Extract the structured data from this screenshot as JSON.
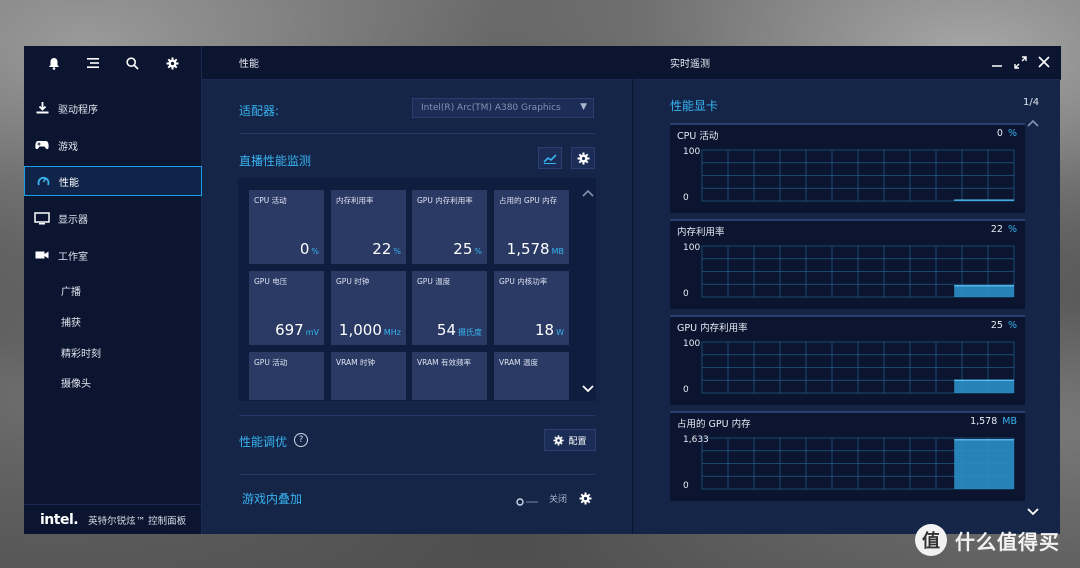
{
  "sidebar": {
    "top_icons": [
      "bell-icon",
      "menu-icon",
      "search-icon",
      "gear-icon"
    ],
    "items": [
      {
        "label": "驱动程序",
        "icon": "download-icon"
      },
      {
        "label": "游戏",
        "icon": "gamepad-icon"
      },
      {
        "label": "性能",
        "icon": "gauge-icon"
      },
      {
        "label": "显示器",
        "icon": "monitor-icon"
      },
      {
        "label": "工作室",
        "icon": "camera-icon"
      }
    ],
    "sub_items": [
      "广播",
      "捕获",
      "精彩时刻",
      "摄像头"
    ],
    "brand_logo": "intel.",
    "brand_text": "英特尔锐炫™ 控制面板"
  },
  "middle": {
    "header": "性能",
    "adapter_label": "适配器:",
    "adapter_value": "Intel(R) Arc(TM) A380 Graphics",
    "monitor_title": "直播性能监测",
    "tiles": [
      {
        "label": "CPU 活动",
        "value": "0",
        "unit": "%"
      },
      {
        "label": "内存利用率",
        "value": "22",
        "unit": "%"
      },
      {
        "label": "GPU 内存利用率",
        "value": "25",
        "unit": "%"
      },
      {
        "label": "占用的 GPU 内存",
        "value": "1,578",
        "unit": "MB"
      },
      {
        "label": "GPU 电压",
        "value": "697",
        "unit": "mV"
      },
      {
        "label": "GPU 时钟",
        "value": "1,000",
        "unit": "MHz"
      },
      {
        "label": "GPU 温度",
        "value": "54",
        "unit": "摄氏度"
      },
      {
        "label": "GPU 内核功率",
        "value": "18",
        "unit": "W"
      },
      {
        "label": "GPU 活动",
        "value": "",
        "unit": ""
      },
      {
        "label": "VRAM 时钟",
        "value": "",
        "unit": ""
      },
      {
        "label": "VRAM 有效频率",
        "value": "",
        "unit": ""
      },
      {
        "label": "VRAM 温度",
        "value": "",
        "unit": ""
      }
    ],
    "tuning_title": "性能调优",
    "config_label": "配置",
    "overlay_title": "游戏内叠加",
    "overlay_state": "关闭"
  },
  "right": {
    "header": "实时遥测",
    "card_title": "性能显卡",
    "pager": "1/4",
    "cards": [
      {
        "title": "CPU 活动",
        "value": "0",
        "unit": "%",
        "ymax": "100",
        "ymin": "0",
        "fill_fraction": 0.0
      },
      {
        "title": "内存利用率",
        "value": "22",
        "unit": "%",
        "ymax": "100",
        "ymin": "0",
        "fill_fraction": 0.22
      },
      {
        "title": "GPU 内存利用率",
        "value": "25",
        "unit": "%",
        "ymax": "100",
        "ymin": "0",
        "fill_fraction": 0.25
      },
      {
        "title": "占用的 GPU 内存",
        "value": "1,578",
        "unit": "MB",
        "ymax": "1,633",
        "ymin": "0",
        "fill_fraction": 0.966
      }
    ]
  },
  "watermark": {
    "symbol": "值",
    "text": "什么值得买"
  },
  "colors": {
    "accent": "#38b3f0",
    "panel": "#142548",
    "dark": "#0c1530",
    "tile": "#2a3a64"
  }
}
